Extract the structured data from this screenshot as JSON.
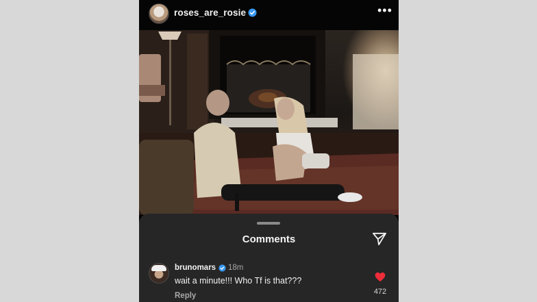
{
  "header": {
    "username": "roses_are_rosie",
    "verified": true,
    "more_icon": "more-horizontal-icon"
  },
  "post": {
    "image_description_icon": "photo"
  },
  "comments_sheet": {
    "title": "Comments",
    "share_icon": "paper-plane-icon"
  },
  "comments": [
    {
      "username": "brunomars",
      "verified": true,
      "time": "18m",
      "text": "wait a minute!!! Who Tf is that???",
      "reply_label": "Reply",
      "liked": true,
      "like_count": "472"
    }
  ],
  "colors": {
    "verified": "#3897f0",
    "heart": "#ed2d3a",
    "sheet_bg": "#262626"
  }
}
